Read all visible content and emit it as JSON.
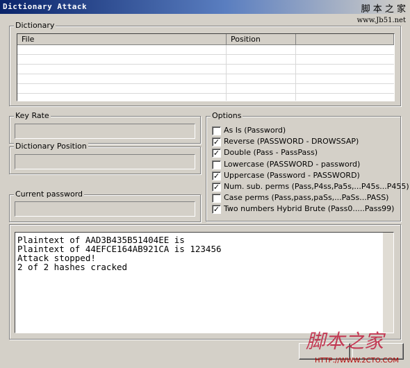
{
  "window": {
    "title": "Dictionary Attack"
  },
  "watermark": {
    "cn": "脚 本 之 家",
    "url": "www.Jb51.net",
    "bottom_text": "脚本之家",
    "bottom_url": "HTTP://WWW.2CTO.COM"
  },
  "dictionary": {
    "label": "Dictionary",
    "columns": [
      "File",
      "Position",
      ""
    ]
  },
  "key_rate": {
    "label": "Key Rate",
    "value": ""
  },
  "dictionary_position": {
    "label": "Dictionary Position",
    "value": ""
  },
  "current_password": {
    "label": "Current password",
    "value": ""
  },
  "options": {
    "label": "Options",
    "items": [
      {
        "label": "As Is (Password)",
        "checked": false
      },
      {
        "label": "Reverse (PASSWORD - DROWSSAP)",
        "checked": true
      },
      {
        "label": "Double (Pass - PassPass)",
        "checked": true
      },
      {
        "label": "Lowercase (PASSWORD - password)",
        "checked": false
      },
      {
        "label": "Uppercase (Password - PASSWORD)",
        "checked": true
      },
      {
        "label": "Num. sub. perms (Pass,P4ss,Pa5s,...P45s...P455)",
        "checked": true
      },
      {
        "label": "Case perms (Pass,pass,paSs,...PaSs...PASS)",
        "checked": false
      },
      {
        "label": "Two numbers Hybrid Brute (Pass0.....Pass99)",
        "checked": true
      }
    ]
  },
  "log": {
    "lines": [
      "Plaintext of AAD3B435B51404EE is",
      "Plaintext of 44EFCE164AB921CA is 123456",
      "Attack stopped!",
      "2 of 2 hashes cracked"
    ]
  }
}
